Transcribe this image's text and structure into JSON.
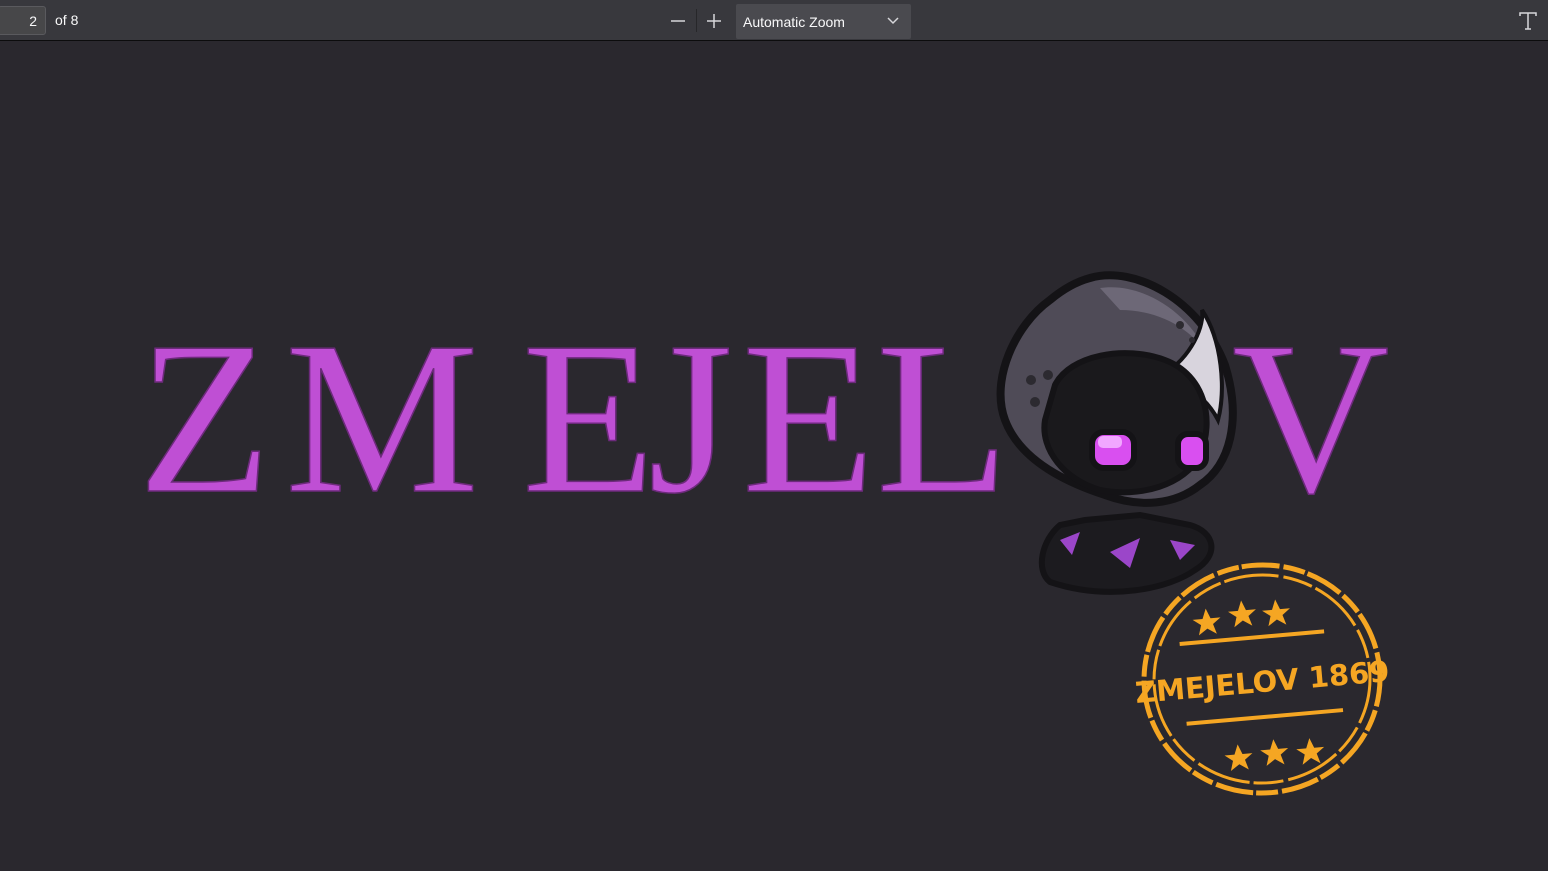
{
  "toolbar": {
    "page_number": "2",
    "page_count": "of 8",
    "zoom_label": "Automatic Zoom"
  },
  "icons": {
    "zoom_out": "minus-icon",
    "zoom_in": "plus-icon",
    "zoom_dropdown": "chevron-down-icon",
    "text_tool": "text-tool-icon"
  },
  "document": {
    "logo_letters_left": [
      "Z",
      "M",
      "E",
      "J",
      "E",
      "L"
    ],
    "logo_letter_right": "V",
    "stamp_text": "ZMEJELOV 1869"
  },
  "colors": {
    "background": "#2a282e",
    "toolbar": "#38383d",
    "logo_purple": "#bf4fd4",
    "stamp_orange": "#f5a623"
  }
}
